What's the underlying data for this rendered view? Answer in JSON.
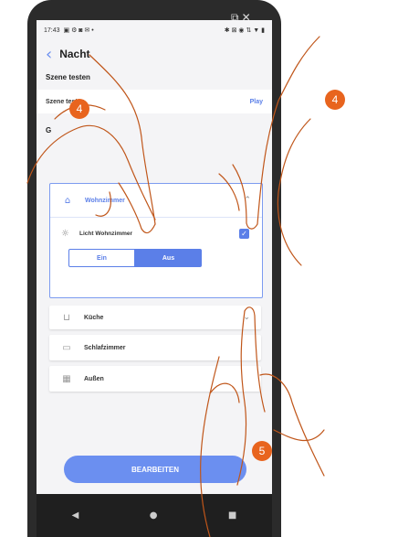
{
  "status": {
    "time": "17:43",
    "left_icons": "▣ ⚙ ◙ ✉ •",
    "right_icons": "✱ ⊠ ◉ ⇅ ▼ ▮"
  },
  "header": {
    "back_icon": "chevron-left-icon",
    "title": "Nacht"
  },
  "test_section": {
    "label": "Szene testen",
    "row_label": "Szene testen",
    "play": "Play"
  },
  "rooms_label": "G",
  "expanded_room": {
    "name": "Wohnzimmer",
    "device": "Licht Wohnzimmer",
    "on_label": "Ein",
    "off_label": "Aus",
    "selected": "Aus"
  },
  "rooms": [
    {
      "name": "Küche",
      "icon": "kitchen-icon"
    },
    {
      "name": "Schlafzimmer",
      "icon": "bed-icon"
    },
    {
      "name": "Außen",
      "icon": "outdoor-icon"
    }
  ],
  "edit_button": "BEARBEITEN",
  "badges": [
    "4",
    "4",
    "5"
  ],
  "colors": {
    "accent": "#6b8ff0",
    "badge": "#e8641e"
  }
}
